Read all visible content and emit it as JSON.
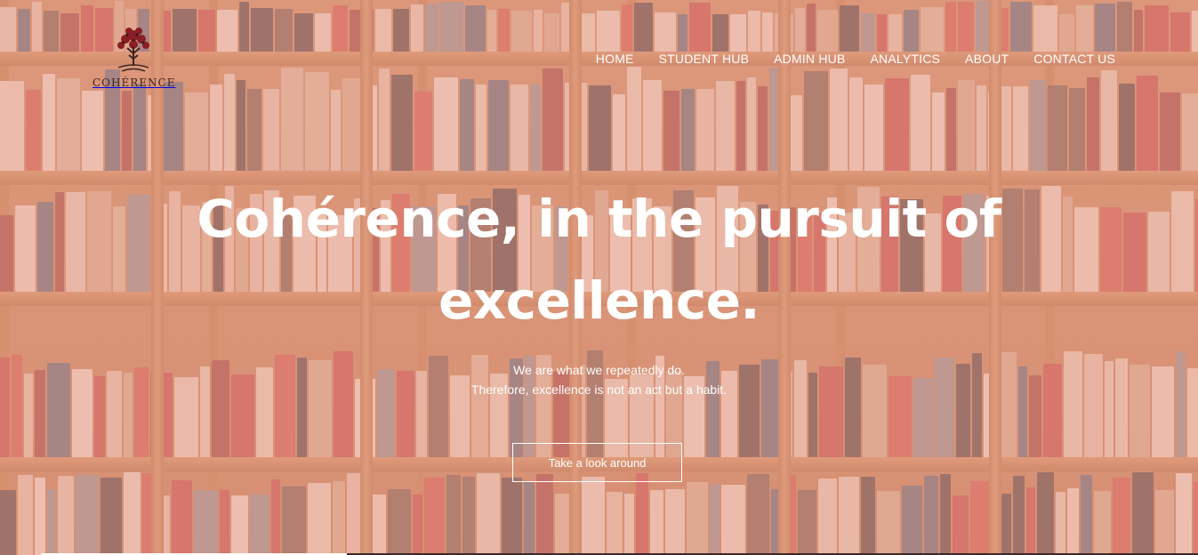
{
  "brand": {
    "logo_text": "COHÉRENCE",
    "logo_icon": "tree-icon"
  },
  "nav": {
    "items": [
      {
        "label": "HOME"
      },
      {
        "label": "STUDENT HUB"
      },
      {
        "label": "ADMIN HUB"
      },
      {
        "label": "ANALYTICS"
      },
      {
        "label": "ABOUT"
      },
      {
        "label": "CONTACT US"
      }
    ]
  },
  "hero": {
    "headline_line1": "Cohérence, in the pursuit of",
    "headline_line2": "excellence.",
    "sub_line1": "We are what we repeatedly do.",
    "sub_line2": "Therefore, excellence is not an act but a habit.",
    "cta_label": "Take a look around"
  },
  "colors": {
    "overlay": "#e8a08c",
    "text": "#ffffff",
    "shelf_wood": "#b8733f"
  }
}
